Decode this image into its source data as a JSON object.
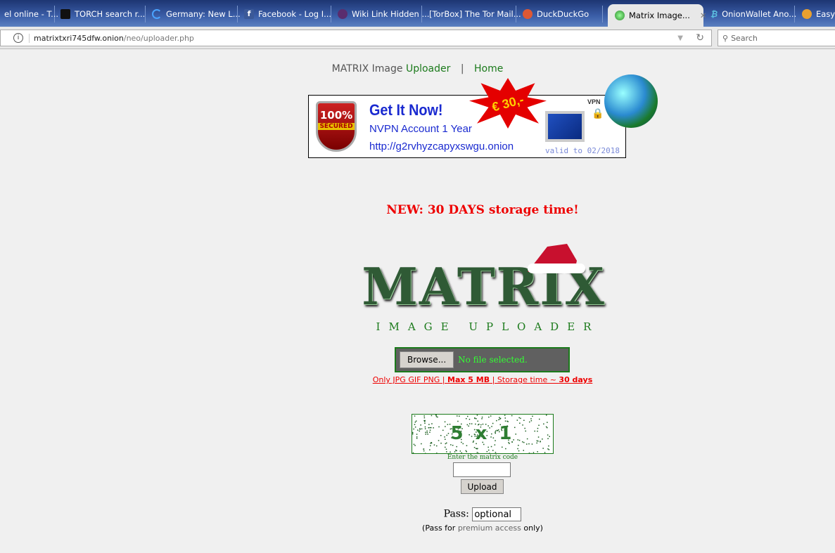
{
  "browser": {
    "tabs": [
      {
        "label": "el online - T...",
        "icon": "page-icon"
      },
      {
        "label": "TORCH search r...",
        "icon": "torch-icon"
      },
      {
        "label": "Germany: New L...",
        "icon": "loading-spinner-icon"
      },
      {
        "label": "Facebook - Log I...",
        "icon": "facebook-icon"
      },
      {
        "label": "Wiki Link Hidden ...",
        "icon": "onion-icon"
      },
      {
        "label": "[TorBox] The Tor Mail...",
        "icon": ""
      },
      {
        "label": "DuckDuckGo",
        "icon": "duckduckgo-icon"
      },
      {
        "label": "Matrix Image...",
        "icon": "matrix-globe-icon",
        "active": true
      },
      {
        "label": "OnionWallet Ano...",
        "icon": "bitcoin-icon"
      },
      {
        "label": "EasyC",
        "icon": "rocket-icon"
      }
    ],
    "url_host": "matrixtxri745dfw.onion",
    "url_path": "/neo/uploader.php",
    "search_placeholder": "Search"
  },
  "topnav": {
    "brand_prefix": "MATRIX Image ",
    "brand_suffix": "Uploader",
    "separator": "|",
    "home": "Home"
  },
  "banner": {
    "badge_top": "100%",
    "badge_bottom": "SECURED",
    "headline": "Get It Now!",
    "product": "NVPN Account 1 Year",
    "link": "http://g2rvhyzcapyxswgu.onion",
    "price": "€ 30,-",
    "vpn_label": "VPN",
    "validity": "valid to 02/2018"
  },
  "notice": "NEW: 30 DAYS storage time!",
  "logo": {
    "title": "MATRIX",
    "subtitle": "IMAGE UPLOADER"
  },
  "upload": {
    "browse_label": "Browse...",
    "file_status": "No file selected.",
    "limits_prefix": "Only JPG GIF PNG | ",
    "limits_size": "Max 5 MB",
    "limits_mid": " | Storage time ~ ",
    "limits_days": "30 days"
  },
  "captcha": {
    "code": "5 x 1",
    "label": "Enter the matrix code",
    "value": ""
  },
  "upload_button": "Upload",
  "pass": {
    "label": "Pass:",
    "value": "optional",
    "note_prefix": "(Pass for ",
    "note_link": "premium access",
    "note_suffix": " only)"
  },
  "colors": {
    "accent_green": "#1b7a1b",
    "alert_red": "#e00000",
    "tabbar": "#2b4a8e"
  }
}
